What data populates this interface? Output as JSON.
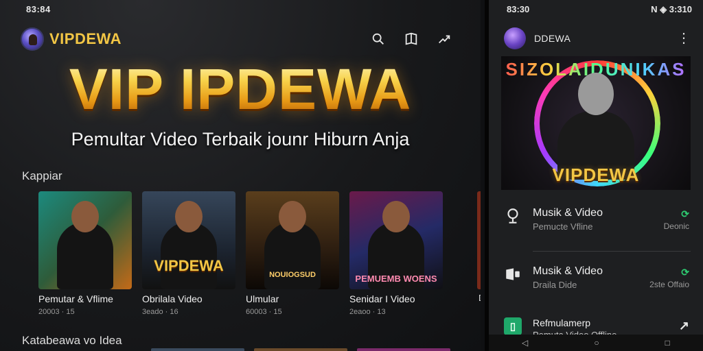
{
  "left": {
    "status_time": "83:84",
    "brand": "VIPDEWA",
    "icons": [
      "search-icon",
      "book-icon",
      "share-icon"
    ],
    "hero_title": "VIP IPDEWA",
    "hero_subtitle": "Pemultar Video Terbaik jounr Hiburn Anja",
    "section1_label": "Kappiar",
    "section2_label": "Katabeawa vo Idea",
    "cards": [
      {
        "title": "Pemutar & Vflime",
        "meta": "20003 · 15",
        "caption": ""
      },
      {
        "title": "Obrilala Video",
        "meta": "3eado · 16",
        "caption": "VIPDEWA"
      },
      {
        "title": "Ulmular",
        "meta": "60003 · 15",
        "caption": "NOUIOGSUD"
      },
      {
        "title": "Senidar I Video",
        "meta": "2eaoo · 13",
        "caption": "PEMUEMB WOENS"
      }
    ],
    "edge_card_title": "D"
  },
  "right": {
    "status_time": "83:30",
    "status_right": "N ◈ 3:310",
    "app_title": "DDEWA",
    "banner_ring_text": "SIZOLAIDUNIKAS",
    "banner_caption": "VIPDEWA",
    "list": [
      {
        "title": "Musik & Video",
        "subtitle": "Pemucte Vfline",
        "action": "⟳",
        "side": "Deonic",
        "icon": "microphone-icon"
      },
      {
        "title": "Musik & Video",
        "subtitle": "Draila Dide",
        "action": "⟳",
        "side": "2ste Offaio",
        "icon": "speaker-icon"
      },
      {
        "title": "Refmulamerp",
        "subtitle": "Pemuta Video Offline",
        "action": "↗",
        "side": "",
        "icon": "offline-video-icon"
      }
    ]
  },
  "colors": {
    "gold": "#f2c645",
    "accent_green": "#2ecc71",
    "background": "#18191b"
  }
}
